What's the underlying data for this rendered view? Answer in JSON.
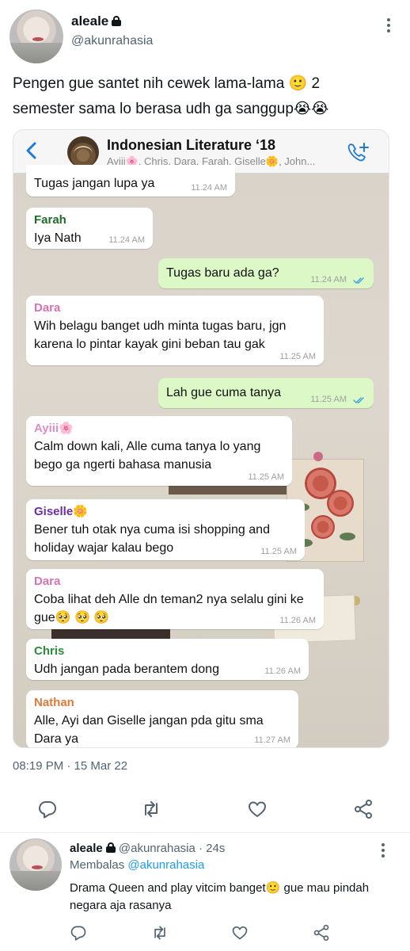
{
  "tweet": {
    "author_name": "aleale",
    "author_handle": "@akunrahasia",
    "text": "Pengen gue santet nih cewek lama-lama 🙂 2 semester sama lo berasa udh ga sanggup😭😭",
    "timestamp": "08:19 PM · 15 Mar 22"
  },
  "whatsapp": {
    "group_title": "Indonesian Literature ‘18",
    "members": "Ayiii🌸, Chris, Dara, Farah, Giselle🌼, John...",
    "messages": [
      {
        "type": "in",
        "sender": "",
        "text": "Tugas jangan lupa ya",
        "time": "11.24 AM"
      },
      {
        "type": "in",
        "sender": "Farah",
        "sender_color": "#1f6b2a",
        "text": "Iya Nath",
        "time": "11.24 AM"
      },
      {
        "type": "out",
        "text": "Tugas baru ada ga?",
        "time": "11.24 AM"
      },
      {
        "type": "in",
        "sender": "Dara",
        "sender_color": "#d774b0",
        "text": "Wih belagu banget udh minta tugas baru, jgn karena lo pintar kayak gini beban tau gak",
        "time": "11.25 AM"
      },
      {
        "type": "out",
        "text": "Lah gue cuma tanya",
        "time": "11.25 AM"
      },
      {
        "type": "in",
        "sender": "Ayiii🌸",
        "sender_color": "#e08cc4",
        "text": "Calm down kali, Alle cuma tanya lo yang bego ga ngerti bahasa manusia",
        "time": "11.25 AM"
      },
      {
        "type": "in",
        "sender": "Giselle🌼",
        "sender_color": "#6b2fa3",
        "text": "Bener tuh otak nya cuma isi shopping and holiday wajar kalau bego",
        "time": "11.25 AM"
      },
      {
        "type": "in",
        "sender": "Dara",
        "sender_color": "#d774b0",
        "text": "Coba lihat deh Alle dn teman2 nya selalu gini ke gue🥺 🥺 🥺",
        "time": "11.26 AM"
      },
      {
        "type": "in",
        "sender": "Chris",
        "sender_color": "#2b8c3c",
        "text": "Udh jangan pada berantem dong",
        "time": "11.26 AM"
      },
      {
        "type": "in",
        "sender": "Nathan",
        "sender_color": "#e07a3a",
        "text": "Alle, Ayi dan Giselle jangan pda gitu sma Dara ya",
        "time": "11.27 AM"
      }
    ]
  },
  "reply": {
    "author_name": "aleale",
    "author_handle": "@akunrahasia",
    "age": "· 24s",
    "replying_prefix": "Membalas",
    "replying_to": "@akunrahasia",
    "text": "Drama Queen and play vitcim banget🙂 gue mau pindah negara aja rasanya"
  },
  "icons": {
    "reply": "speech-bubble-icon",
    "retweet": "retweet-icon",
    "like": "heart-icon",
    "share": "share-icon",
    "more": "more-vertical-icon",
    "lock": "lock-icon"
  },
  "colors": {
    "accent": "#1d9bf0",
    "outgoing_bubble": "#dcf8c6",
    "whatsapp_blue": "#1f7ad6"
  }
}
